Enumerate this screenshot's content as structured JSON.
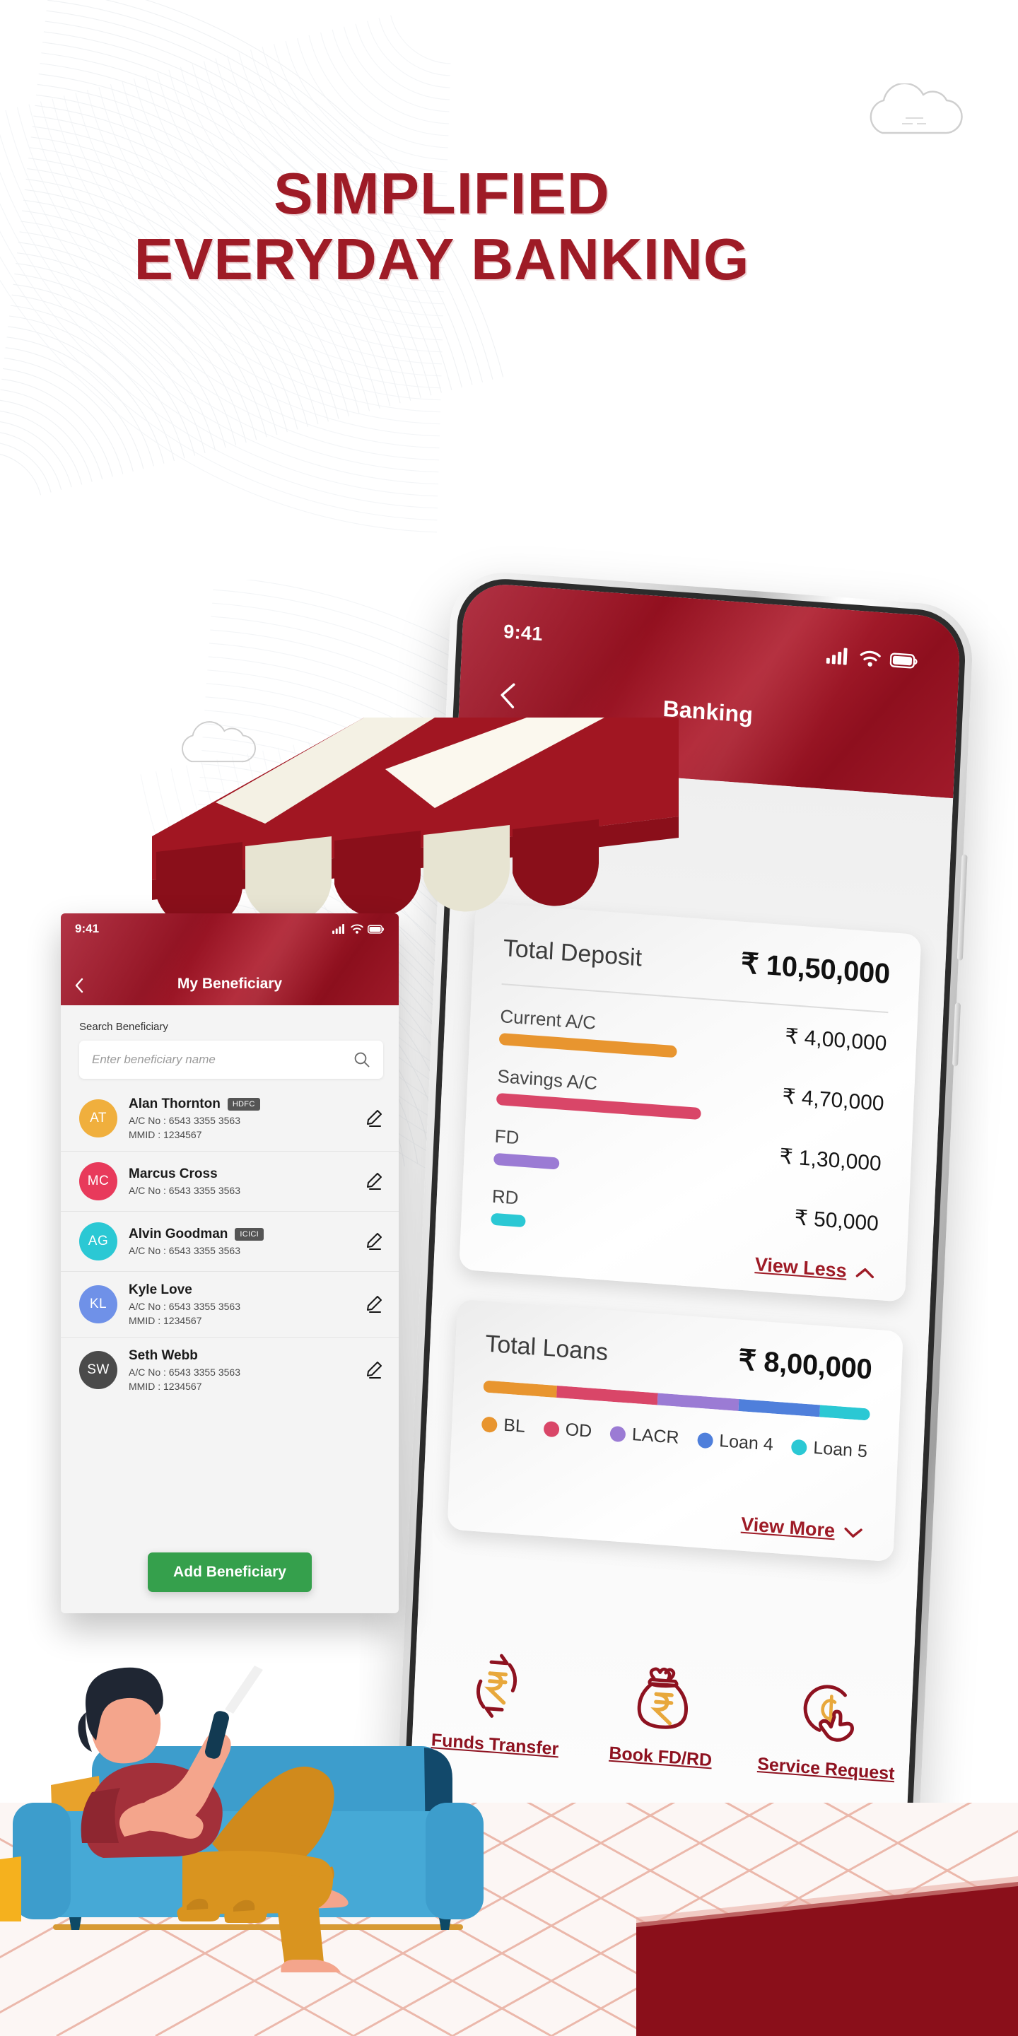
{
  "headline": {
    "line1": "SIMPLIFIED",
    "line2": "EVERYDAY BANKING",
    "color": "#9E1B26"
  },
  "phone": {
    "status": {
      "time": "9:41",
      "signal_icon": "signal-bars-icon",
      "wifi_icon": "wifi-icon",
      "battery_icon": "battery-icon"
    },
    "header": {
      "title": "Banking",
      "back_icon": "chevron-left-icon"
    },
    "deposit_card": {
      "label": "Total Deposit",
      "amount": "₹ 10,50,000",
      "toggle_label": "View Less",
      "toggle_icon": "chevron-up-icon"
    },
    "loans_card": {
      "label": "Total Loans",
      "amount": "₹ 8,00,000",
      "toggle_label": "View More",
      "toggle_icon": "chevron-down-icon"
    },
    "quick_actions": [
      {
        "label": "Funds  Transfer",
        "icon": "rupee-transfer-arrows-icon"
      },
      {
        "label": "Book FD/RD",
        "icon": "money-bag-rupee-icon"
      },
      {
        "label": "Service Request",
        "icon": "coin-tap-hand-icon"
      }
    ]
  },
  "chart_data": [
    {
      "type": "bar",
      "title": "Total Deposit",
      "total": "₹ 10,50,000",
      "total_value": 1050000,
      "orientation": "horizontal",
      "categories": [
        "Current A/C",
        "Savings A/C",
        "FD",
        "RD"
      ],
      "values": [
        400000,
        470000,
        130000,
        50000
      ],
      "value_labels": [
        "₹ 4,00,000",
        "₹ 4,70,000",
        "₹ 1,30,000",
        "₹ 50,000"
      ],
      "colors": [
        "#E8952F",
        "#D94668",
        "#9B7BD4",
        "#2BC8D4"
      ],
      "grid": false,
      "legend": "none",
      "xlabel": "",
      "ylabel": ""
    },
    {
      "type": "bar",
      "subtype": "stacked-single-bar",
      "title": "Total Loans",
      "total": "₹ 8,00,000",
      "total_value": 800000,
      "orientation": "horizontal",
      "categories": [
        "BL",
        "OD",
        "LACR",
        "Loan 4",
        "Loan 5"
      ],
      "values": [
        19,
        26,
        21,
        21,
        13
      ],
      "value_unit": "percent-of-bar",
      "colors": [
        "#E8952F",
        "#D94668",
        "#9B7BD4",
        "#4F7FDB",
        "#2BC8D4"
      ],
      "grid": false,
      "legend": "bottom",
      "xlabel": "",
      "ylabel": ""
    }
  ],
  "beneficiary": {
    "status": {
      "time": "9:41",
      "signal_icon": "signal-bars-icon",
      "wifi_icon": "wifi-icon",
      "battery_icon": "battery-icon"
    },
    "title": "My Beneficiary",
    "back_icon": "chevron-left-icon",
    "search_label": "Search Beneficiary",
    "search_placeholder": "Enter beneficiary name",
    "search_value": "",
    "search_icon": "search-icon",
    "edit_icon": "pencil-edit-icon",
    "add_button": "Add Beneficiary",
    "add_button_color": "#35A04C",
    "items": [
      {
        "initials": "AT",
        "color": "#F0AF3D",
        "name": "Alan Thornton",
        "tag": "HDFC",
        "account": "A/C No : 6543 3355 3563",
        "mmid": "MMID : 1234567"
      },
      {
        "initials": "MC",
        "color": "#E83A5B",
        "name": "Marcus Cross",
        "tag": "",
        "account": "A/C No : 6543 3355 3563",
        "mmid": ""
      },
      {
        "initials": "AG",
        "color": "#2BC8D4",
        "name": "Alvin Goodman",
        "tag": "ICICI",
        "account": "A/C No : 6543 3355 3563",
        "mmid": ""
      },
      {
        "initials": "KL",
        "color": "#6F91E8",
        "name": "Kyle Love",
        "tag": "",
        "account": "A/C No : 6543 3355 3563",
        "mmid": "MMID : 1234567"
      },
      {
        "initials": "SW",
        "color": "#4A4A4A",
        "name": "Seth Webb",
        "tag": "",
        "account": "A/C No : 6543 3355 3563",
        "mmid": "MMID : 1234567"
      }
    ]
  },
  "decor": {
    "cloud_icon": "cloud-outline-icon",
    "awning_icon": "shop-awning-icon",
    "illustration_icon": "man-on-sofa-with-phone-illustration",
    "counter_icon": "red-counter-icon",
    "floor_icon": "tiled-floor-icon"
  }
}
